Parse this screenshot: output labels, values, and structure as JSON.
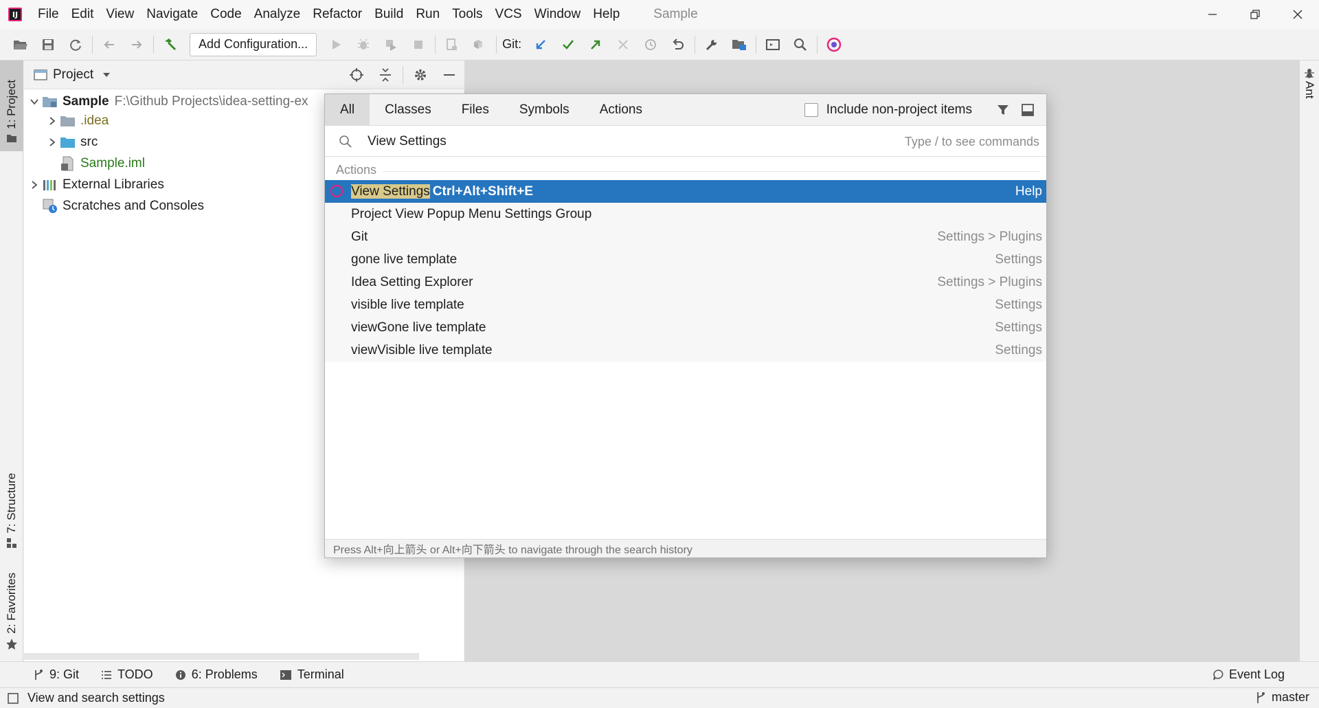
{
  "menubar": {
    "items": [
      "File",
      "Edit",
      "View",
      "Navigate",
      "Code",
      "Analyze",
      "Refactor",
      "Build",
      "Run",
      "Tools",
      "VCS",
      "Window",
      "Help"
    ],
    "window_title": "Sample"
  },
  "toolbar": {
    "config_label": "Add Configuration...",
    "git_label": "Git:"
  },
  "left_strip": {
    "project_tab": "1: Project",
    "structure_tab": "7: Structure",
    "favorites_tab": "2: Favorites"
  },
  "right_strip": {
    "ant_tab": "Ant"
  },
  "project_panel": {
    "title": "Project",
    "tree": {
      "root_name": "Sample",
      "root_path": "F:\\Github Projects\\idea-setting-ex",
      "idea": ".idea",
      "src": "src",
      "iml": "Sample.iml",
      "ext_libs": "External Libraries",
      "scratches": "Scratches and Consoles"
    }
  },
  "popup": {
    "tabs": [
      "All",
      "Classes",
      "Files",
      "Symbols",
      "Actions"
    ],
    "active_tab": "All",
    "include_label": "Include non-project items",
    "search_value": "View Settings",
    "search_hint": "Type / to see commands",
    "group_label": "Actions",
    "results": [
      {
        "name_hl": "View Settings",
        "shortcut": "Ctrl+Alt+Shift+E",
        "location": "Help",
        "selected": true
      },
      {
        "name": "Project View Popup Menu Settings Group",
        "location": ""
      },
      {
        "name": "Git",
        "location": "Settings > Plugins"
      },
      {
        "name": "gone live template",
        "location": "Settings"
      },
      {
        "name": "Idea Setting Explorer",
        "location": "Settings > Plugins"
      },
      {
        "name": "visible live template",
        "location": "Settings"
      },
      {
        "name": "viewGone live template",
        "location": "Settings"
      },
      {
        "name": "viewVisible live template",
        "location": "Settings"
      }
    ],
    "footer": "Press Alt+向上箭头 or Alt+向下箭头 to navigate through the search history"
  },
  "bottom_tools": {
    "git": "9: Git",
    "todo": "TODO",
    "problems": "6: Problems",
    "terminal": "Terminal",
    "event_log": "Event Log"
  },
  "statusbar": {
    "text": "View and search settings",
    "branch": "master"
  },
  "colors": {
    "selection": "#2675bf",
    "highlight": "#d8c98a",
    "accent_green": "#3a8a2a",
    "accent_blue": "#2f7fd4"
  }
}
